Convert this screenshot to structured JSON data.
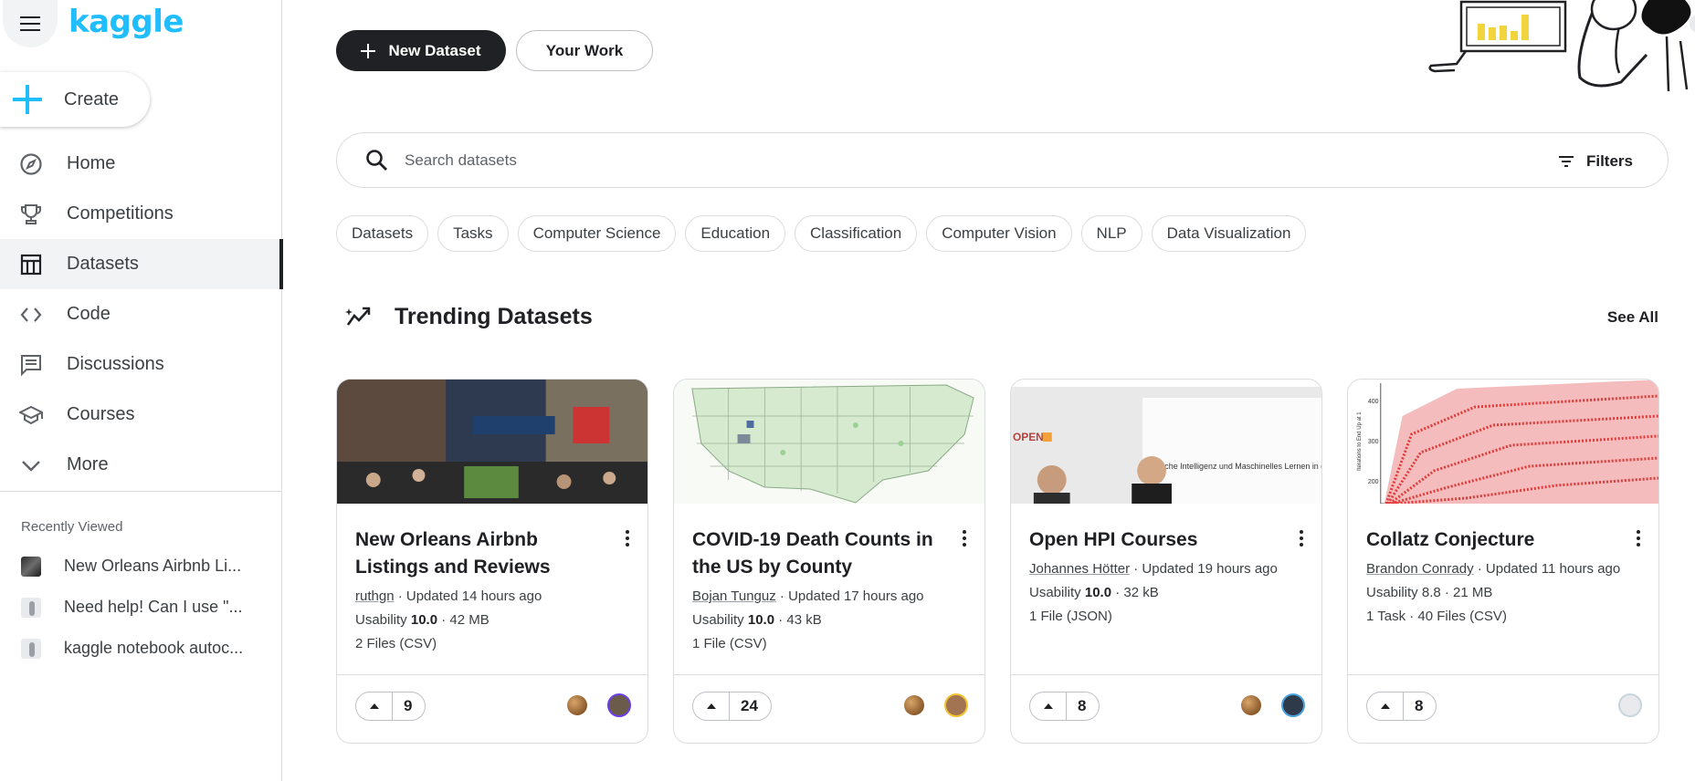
{
  "app": {
    "logo_text": "kaggle"
  },
  "sidebar": {
    "create_label": "Create",
    "nav": [
      {
        "label": "Home",
        "icon": "compass-icon"
      },
      {
        "label": "Competitions",
        "icon": "trophy-icon"
      },
      {
        "label": "Datasets",
        "icon": "table-icon",
        "active": true
      },
      {
        "label": "Code",
        "icon": "code-icon"
      },
      {
        "label": "Discussions",
        "icon": "comments-icon"
      },
      {
        "label": "Courses",
        "icon": "school-icon"
      },
      {
        "label": "More",
        "icon": "chevron-down-icon"
      }
    ],
    "recent_title": "Recently Viewed",
    "recent": [
      {
        "label": "New Orleans Airbnb Li..."
      },
      {
        "label": "Need help! Can I use \"..."
      },
      {
        "label": "kaggle notebook autoc..."
      }
    ]
  },
  "header": {
    "new_dataset_label": "New Dataset",
    "your_work_label": "Your Work"
  },
  "search": {
    "placeholder": "Search datasets",
    "filters_label": "Filters"
  },
  "chips": [
    "Datasets",
    "Tasks",
    "Computer Science",
    "Education",
    "Classification",
    "Computer Vision",
    "NLP",
    "Data Visualization"
  ],
  "section": {
    "title": "Trending Datasets",
    "see_all_label": "See All"
  },
  "cards": [
    {
      "title": "New Orleans Airbnb Listings and Reviews",
      "author": "ruthgn",
      "updated": " · Updated 14 hours ago",
      "usability_prefix": "Usability ",
      "usability": "10.0",
      "size": " · 42 MB",
      "files": "2 Files (CSV)",
      "votes": "9",
      "avatar_ring": "#6a3de8"
    },
    {
      "title": "COVID-19 Death Counts in the US by County",
      "author": "Bojan Tunguz",
      "updated": " · Updated 17 hours ago",
      "usability_prefix": "Usability ",
      "usability": "10.0",
      "size": " · 43 kB",
      "files": "1 File (CSV)",
      "votes": "24",
      "avatar_ring": "#f2c230"
    },
    {
      "title": "Open HPI Courses",
      "author": "Johannes Hötter",
      "updated": " · Updated 19 hours ago",
      "usability_prefix": "Usability ",
      "usability": "10.0",
      "size": " · 32 kB",
      "files": "1 File (JSON)",
      "votes": "8",
      "avatar_ring": "#4aa3df"
    },
    {
      "title": "Collatz Conjecture",
      "author": "Brandon Conrady",
      "updated": " · Updated 11 hours ago",
      "usability_prefix": "Usability ",
      "usability": "8.8",
      "size": " · 21 MB",
      "files": "1 Task · 40 Files (CSV)",
      "votes": "8",
      "avatar_ring": "#c8d4dc"
    }
  ],
  "image_texts": {
    "hpi_logo": "OPEN",
    "hpi_slide": "Künstliche Intelligenz und Maschinelles Lernen in der Praxis",
    "collatz_ylabel": "Iterations to End Up at 1",
    "collatz_ticks": [
      "400",
      "300",
      "200"
    ]
  },
  "colors": {
    "brand": "#20beff",
    "primary": "#202124"
  }
}
